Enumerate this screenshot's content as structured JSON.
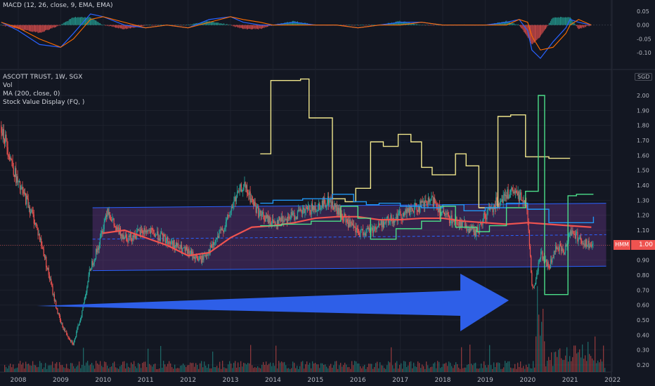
{
  "macd_legend": "MACD (12, 26, close, 9, EMA, EMA)",
  "main_legend": {
    "symbol": "ASCOTT TRUST, 1W, SGX",
    "vol": "Vol",
    "ma": "MA (200, close, 0)",
    "stock_value": "Stock Value Display (FQ, )"
  },
  "currency": "SGD",
  "last_price": "1.00",
  "last_price_tag": "HMM",
  "colors": {
    "background": "#131722",
    "up": "#26a69a",
    "down": "#ef5350",
    "ma": "#ef5350",
    "stock_value_yellow": "#f0e68c",
    "stock_value_blue": "#2196f3",
    "stock_value_green": "#4cdf8a",
    "channel_fill": "#7b3fa3",
    "channel_line": "#2962ff",
    "arrow": "#2e5fe8",
    "macd_line": "#2962ff",
    "signal_line": "#ff6d00"
  },
  "chart_data": [
    {
      "type": "line",
      "title": "MACD (12, 26, close, 9, EMA, EMA)",
      "ylim": [
        -0.15,
        0.07
      ],
      "yticks": [
        "0.05",
        "0.00",
        "-0.05",
        "-0.10"
      ],
      "series": [
        {
          "x": [
            2007.6,
            2008.0,
            2008.5,
            2009.0,
            2009.3,
            2009.7,
            2010.0,
            2010.5,
            2011.0,
            2011.5,
            2012.0,
            2012.5,
            2013.0,
            2013.3,
            2013.7,
            2014.0,
            2014.5,
            2015.0,
            2015.5,
            2016.0,
            2016.5,
            2017.0,
            2017.5,
            2018.0,
            2018.5,
            2019.0,
            2019.5,
            2019.8,
            2020.0,
            2020.1,
            2020.3,
            2020.6,
            2020.9,
            2021.0,
            2021.2,
            2021.5
          ],
          "values": [
            0.01,
            -0.02,
            -0.07,
            -0.08,
            -0.03,
            0.04,
            0.03,
            0.0,
            -0.01,
            0.0,
            -0.01,
            0.02,
            0.03,
            0.01,
            0.0,
            0.0,
            0.01,
            0.0,
            0.0,
            -0.01,
            0.0,
            0.01,
            0.01,
            0.0,
            0.0,
            0.0,
            0.01,
            0.02,
            -0.02,
            -0.09,
            -0.12,
            -0.06,
            -0.01,
            0.02,
            0.01,
            0.0
          ]
        },
        {
          "x": [
            2007.6,
            2008.0,
            2008.5,
            2009.0,
            2009.3,
            2009.7,
            2010.0,
            2010.5,
            2011.0,
            2011.5,
            2012.0,
            2012.5,
            2013.0,
            2013.3,
            2013.7,
            2014.0,
            2014.5,
            2015.0,
            2015.5,
            2016.0,
            2016.5,
            2017.0,
            2017.5,
            2018.0,
            2018.5,
            2019.0,
            2019.5,
            2019.8,
            2020.0,
            2020.1,
            2020.3,
            2020.6,
            2020.9,
            2021.0,
            2021.2,
            2021.5
          ],
          "values": [
            0.01,
            -0.01,
            -0.05,
            -0.08,
            -0.05,
            0.02,
            0.03,
            0.01,
            -0.01,
            0.0,
            -0.01,
            0.01,
            0.03,
            0.02,
            0.01,
            0.0,
            0.0,
            0.0,
            0.0,
            -0.01,
            0.0,
            0.0,
            0.01,
            0.0,
            0.0,
            0.0,
            0.0,
            0.02,
            0.01,
            -0.04,
            -0.09,
            -0.08,
            -0.03,
            0.0,
            0.02,
            0.0
          ]
        }
      ]
    },
    {
      "type": "line",
      "title": "ASCOTT TRUST, 1W, SGX",
      "x_ticks": [
        "2008",
        "2009",
        "2010",
        "2011",
        "2012",
        "2013",
        "2014",
        "2015",
        "2016",
        "2017",
        "2018",
        "2019",
        "2020",
        "2021",
        "2022"
      ],
      "ylim": [
        0.15,
        2.15
      ],
      "yticks": [
        "2.00",
        "1.90",
        "1.80",
        "1.70",
        "1.60",
        "1.50",
        "1.40",
        "1.30",
        "1.20",
        "1.10",
        "1.00",
        "0.90",
        "0.80",
        "0.70",
        "0.60",
        "0.50",
        "0.40",
        "0.30",
        "0.20"
      ],
      "price": {
        "x": [
          2007.6,
          2007.8,
          2008.0,
          2008.2,
          2008.4,
          2008.6,
          2008.8,
          2008.9,
          2009.0,
          2009.15,
          2009.3,
          2009.5,
          2009.7,
          2009.9,
          2010.1,
          2010.3,
          2010.6,
          2011.0,
          2011.4,
          2011.8,
          2012.0,
          2012.3,
          2012.6,
          2012.9,
          2013.1,
          2013.3,
          2013.5,
          2013.7,
          2014.0,
          2014.5,
          2015.0,
          2015.3,
          2015.6,
          2016.0,
          2016.3,
          2016.6,
          2017.0,
          2017.4,
          2017.8,
          2018.0,
          2018.4,
          2018.8,
          2019.0,
          2019.3,
          2019.6,
          2019.9,
          2020.0,
          2020.1,
          2020.15,
          2020.3,
          2020.5,
          2020.7,
          2020.85,
          2021.0,
          2021.2,
          2021.4,
          2021.55
        ],
        "values": [
          1.8,
          1.6,
          1.4,
          1.3,
          1.15,
          0.95,
          0.7,
          0.58,
          0.48,
          0.4,
          0.34,
          0.55,
          0.85,
          1.0,
          1.25,
          1.1,
          1.05,
          1.1,
          1.05,
          0.98,
          0.95,
          0.9,
          1.0,
          1.15,
          1.3,
          1.4,
          1.3,
          1.2,
          1.15,
          1.2,
          1.25,
          1.3,
          1.2,
          1.08,
          1.1,
          1.15,
          1.2,
          1.25,
          1.3,
          1.2,
          1.15,
          1.08,
          1.2,
          1.3,
          1.35,
          1.32,
          1.2,
          0.75,
          0.7,
          0.95,
          0.85,
          1.0,
          0.95,
          1.1,
          1.05,
          1.0,
          1.0
        ]
      },
      "ma200": {
        "x": [
          2010.0,
          2010.5,
          2011.0,
          2011.5,
          2012.0,
          2012.5,
          2013.0,
          2013.5,
          2014.0,
          2014.5,
          2015.0,
          2015.5,
          2016.0,
          2016.5,
          2017.0,
          2017.5,
          2018.0,
          2018.5,
          2019.0,
          2019.5,
          2020.0,
          2020.5,
          2021.0,
          2021.5
        ],
        "values": [
          1.08,
          1.1,
          1.05,
          1.0,
          0.93,
          0.95,
          1.05,
          1.12,
          1.13,
          1.15,
          1.18,
          1.19,
          1.19,
          1.17,
          1.17,
          1.18,
          1.18,
          1.16,
          1.15,
          1.14,
          1.15,
          1.14,
          1.13,
          1.12
        ]
      },
      "channel": {
        "x_start": 2009.75,
        "x_end": 2021.85,
        "upper_start": 1.25,
        "upper_end": 1.28,
        "lower_start": 0.83,
        "lower_end": 0.86,
        "mid_start": 1.04,
        "mid_end": 1.07
      },
      "series": [
        {
          "x": [
            2013.7,
            2013.95,
            2013.95,
            2014.65,
            2014.65,
            2014.85,
            2014.85,
            2015.4,
            2015.4,
            2015.7,
            2015.7,
            2015.95,
            2015.95,
            2016.3,
            2016.3,
            2016.6,
            2016.6,
            2016.95,
            2016.95,
            2017.25,
            2017.25,
            2017.5,
            2017.5,
            2017.75,
            2017.75,
            2018.3,
            2018.3,
            2018.55,
            2018.55,
            2018.85,
            2018.85,
            2019.3,
            2019.3,
            2019.6,
            2019.6,
            2019.95,
            2019.95,
            2020.5,
            2020.5,
            2021.0
          ],
          "values": [
            1.61,
            1.61,
            2.1,
            2.1,
            2.11,
            2.11,
            1.85,
            1.85,
            1.31,
            1.31,
            1.29,
            1.29,
            1.38,
            1.38,
            1.69,
            1.69,
            1.66,
            1.66,
            1.74,
            1.74,
            1.69,
            1.69,
            1.52,
            1.52,
            1.47,
            1.47,
            1.61,
            1.61,
            1.53,
            1.53,
            1.25,
            1.25,
            1.86,
            1.86,
            1.87,
            1.87,
            1.59,
            1.59,
            1.58,
            1.58
          ]
        },
        {
          "x": [
            2013.7,
            2014.0,
            2014.0,
            2014.7,
            2014.7,
            2015.4,
            2015.4,
            2015.9,
            2015.9,
            2016.2,
            2016.2,
            2016.5,
            2016.5,
            2017.0,
            2017.0,
            2017.5,
            2017.5,
            2018.0,
            2018.0,
            2018.5,
            2018.5,
            2019.0,
            2019.0,
            2019.5,
            2019.5,
            2020.0,
            2020.0,
            2020.5,
            2020.5,
            2021.0,
            2021.0,
            2021.55,
            2021.55
          ],
          "values": [
            1.28,
            1.28,
            1.3,
            1.3,
            1.31,
            1.31,
            1.34,
            1.34,
            1.29,
            1.29,
            1.27,
            1.27,
            1.28,
            1.28,
            1.26,
            1.26,
            1.25,
            1.25,
            1.27,
            1.27,
            1.23,
            1.23,
            1.25,
            1.25,
            1.28,
            1.28,
            1.24,
            1.24,
            1.15,
            1.15,
            1.15,
            1.15,
            1.19
          ]
        },
        {
          "x": [
            2013.7,
            2014.2,
            2014.2,
            2014.9,
            2014.9,
            2015.6,
            2015.6,
            2016.0,
            2016.0,
            2016.3,
            2016.3,
            2016.9,
            2016.9,
            2017.5,
            2017.5,
            2017.95,
            2017.95,
            2018.3,
            2018.3,
            2018.8,
            2018.8,
            2019.1,
            2019.1,
            2019.5,
            2019.5,
            2019.95,
            2019.95,
            2020.25,
            2020.25,
            2020.4,
            2020.4,
            2020.95,
            2020.95,
            2021.15,
            2021.15,
            2021.55
          ],
          "values": [
            1.13,
            1.13,
            1.14,
            1.14,
            1.16,
            1.16,
            1.26,
            1.26,
            1.18,
            1.18,
            1.04,
            1.04,
            1.11,
            1.11,
            1.16,
            1.16,
            1.26,
            1.26,
            1.12,
            1.12,
            1.09,
            1.09,
            1.13,
            1.13,
            1.25,
            1.25,
            1.36,
            1.36,
            2.0,
            2.0,
            0.67,
            0.67,
            1.33,
            1.33,
            1.34,
            1.34
          ]
        }
      ]
    }
  ]
}
